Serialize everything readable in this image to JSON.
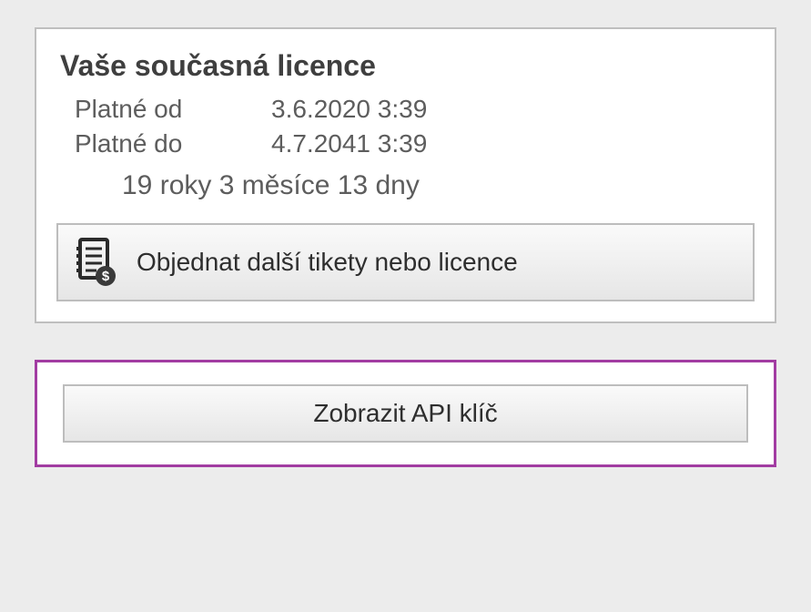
{
  "license": {
    "title": "Vaše současná licence",
    "valid_from_label": "Platné od",
    "valid_from_value": "3.6.2020 3:39",
    "valid_to_label": "Platné do",
    "valid_to_value": "4.7.2041 3:39",
    "duration": "19 roky 3 měsíce 13 dny",
    "order_button": "Objednat další tikety nebo licence"
  },
  "api": {
    "show_key_button": "Zobrazit API klíč"
  }
}
